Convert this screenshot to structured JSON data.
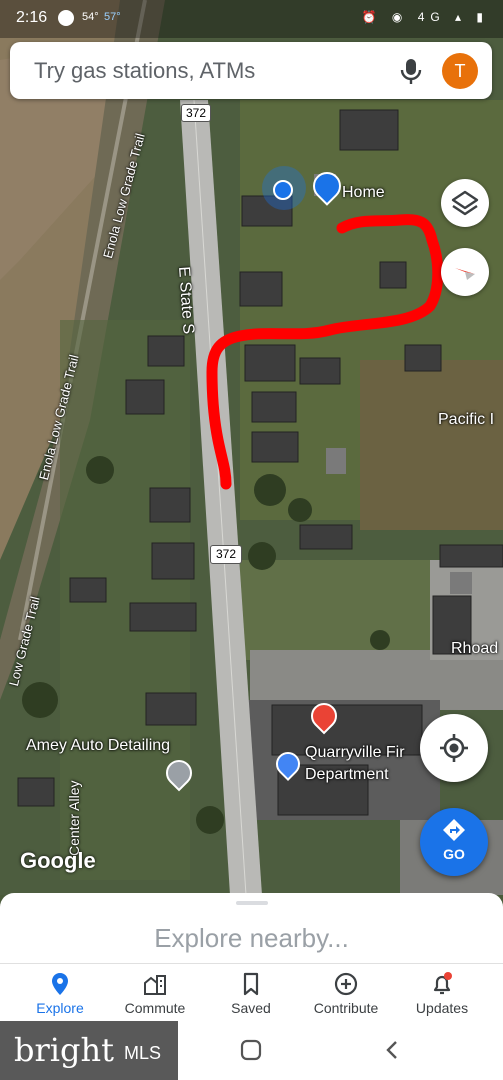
{
  "status_bar": {
    "time": "2:16",
    "temp": "54°",
    "temp2": "57°",
    "right_icons": "⏰ ◉ 4G ▴ ▮"
  },
  "search": {
    "placeholder": "Try gas stations, ATMs",
    "avatar_letter": "T"
  },
  "map": {
    "labels": {
      "route_shield_top": "372",
      "route_shield_bottom": "372",
      "road_name": "E State S",
      "trail_top": "Enola Low Grade Trail",
      "trail_mid": "Enola Low Grade Trail",
      "trail_bottom": "Low Grade Trail",
      "home": "Home",
      "pacific": "Pacific I",
      "rhoad": "Rhoad",
      "amey": "Amey Auto Detailing",
      "fire_dept_line1": "Quarryville Fir",
      "fire_dept_line2": "Department",
      "alley": "Center Alley"
    },
    "attribution": "Google"
  },
  "go_button": {
    "label": "GO"
  },
  "sheet": {
    "title": "Explore nearby..."
  },
  "nav": [
    {
      "label": "Explore",
      "icon": "explore-pin-icon"
    },
    {
      "label": "Commute",
      "icon": "commute-buildings-icon"
    },
    {
      "label": "Saved",
      "icon": "bookmark-icon"
    },
    {
      "label": "Contribute",
      "icon": "plus-circle-icon"
    },
    {
      "label": "Updates",
      "icon": "bell-icon"
    }
  ],
  "watermark": {
    "brand": "bright",
    "suffix": "MLS"
  },
  "colors": {
    "accent": "#1a73e8",
    "route": "#ff0000",
    "avatar": "#e8710a",
    "fire_pin": "#ea4335"
  }
}
